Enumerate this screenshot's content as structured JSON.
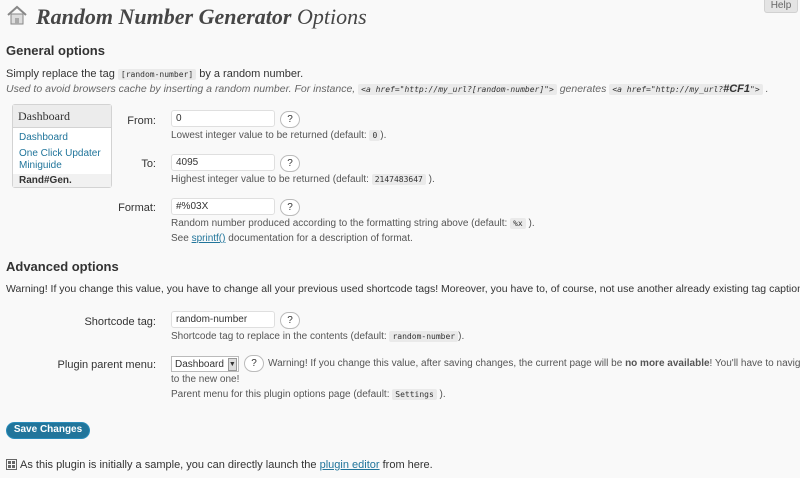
{
  "header": {
    "help_label": "Help",
    "title_strong": "Random Number Generator",
    "title_rest": " Options"
  },
  "general": {
    "heading": "General options",
    "intro_pre": "Simply replace the tag ",
    "intro_tag": "[random-number]",
    "intro_post": " by a random number.",
    "cache_pre": "Used to avoid browsers cache by inserting a random number. For instance, ",
    "cache_code1": "<a href=\"http://my_url?[random-number]\">",
    "cache_mid": " generates ",
    "cache_code2": "<a href=\"http://my_url?",
    "cache_code2_strong": "#CF1",
    "cache_code2_end": "\">",
    "cache_end": " ."
  },
  "sidebar": {
    "title": "Dashboard",
    "items": [
      "Dashboard",
      "One Click Updater",
      "Miniguide",
      "Rand#Gen."
    ]
  },
  "fields": {
    "from": {
      "label": "From:",
      "value": "0",
      "help": "?",
      "desc_pre": "Lowest integer value to be returned (default: ",
      "desc_code": "0",
      "desc_post": ")."
    },
    "to": {
      "label": "To:",
      "value": "4095",
      "help": "?",
      "desc_pre": "Highest integer value to be returned (default: ",
      "desc_code": "2147483647",
      "desc_post": " )."
    },
    "format": {
      "label": "Format:",
      "value": "#%03X",
      "help": "?",
      "desc_pre": "Random number produced according to the formatting string above (default: ",
      "desc_code": "%x",
      "desc_post": " ).",
      "see_pre": "See ",
      "see_link": "sprintf()",
      "see_post": " documentation for a description of format."
    }
  },
  "advanced": {
    "heading": "Advanced options",
    "warning": "Warning! If you change this value, you have to change all your previous used shortcode tags! Moreover, you have to, of course, not use another already existing tag caption!",
    "shortcode": {
      "label": "Shortcode tag:",
      "value": "random-number",
      "help": "?",
      "desc_pre": "Shortcode tag to replace in the contents (default: ",
      "desc_code": "random-number",
      "desc_post": ")."
    },
    "parent_menu": {
      "label": "Plugin parent menu:",
      "selected": "Dashboard",
      "help": "?",
      "warn_pre": "Warning! If you change this value, after saving changes, the current page will be ",
      "warn_strong": "no more available",
      "warn_post": "! You'll have to navigate",
      "warn_line2": "to the new one!",
      "desc_pre": "Parent menu for this plugin options page (default: ",
      "desc_code": "Settings",
      "desc_post": " )."
    }
  },
  "footer": {
    "save_label": "Save Changes",
    "note_pre": "As this plugin is initially a sample, you can directly launch the ",
    "note_link": "plugin editor",
    "note_post": " from here."
  },
  "icons": {
    "page": "house-icon",
    "select_arrow": "chevron-down-icon",
    "note": "grip-icon"
  }
}
